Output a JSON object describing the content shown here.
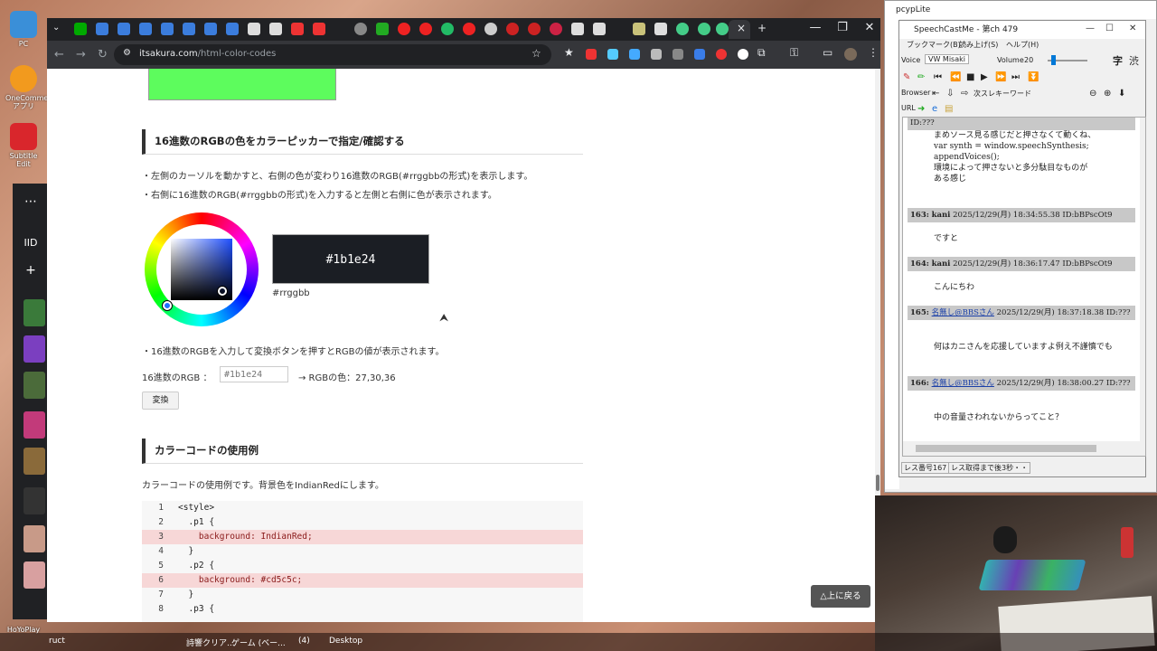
{
  "desktop": {
    "icons": [
      {
        "label": "PC",
        "icon": "pc-icon",
        "color": "#3a8fd8"
      },
      {
        "label": "OneCommeアプリ",
        "icon": "onecomme-icon",
        "color": "#f29a1e"
      },
      {
        "label": "Subtitle Edit",
        "icon": "subtitle-edit-icon",
        "color": "#d9262c"
      }
    ],
    "sidebar_menu": "⋯",
    "sidebar_tab": "IID",
    "sidebar_add": "+",
    "bottom_label": "HoYoPlay"
  },
  "taskbar": {
    "items": [
      "ruct",
      "詩響クリア...",
      "ゲーム (ベー...",
      "(4)",
      "Desktop"
    ]
  },
  "browser": {
    "url_host": "itsakura.com",
    "url_path": "/html-color-codes",
    "tab_close": "×",
    "new_tab": "+",
    "window_controls": [
      "—",
      "❐",
      "✕"
    ],
    "page": {
      "section1_heading": "16進数のRGBの色をカラーピッカーで指定/確認する",
      "bullet1": "・左側のカーソルを動かすと、右側の色が変わり16進数のRGB(#rrggbbの形式)を表示します。",
      "bullet2": "・右側に16進数のRGB(#rrggbbの形式)を入力すると左側と右側に色が表示されます。",
      "picker_value": "#1b1e24",
      "picker_caption": "#rrggbb",
      "bullet3": "・16進数のRGBを入力して変換ボタンを押すとRGBの値が表示されます。",
      "hex_label": "16進数のRGB ：",
      "hex_placeholder": "#1b1e24",
      "rgb_result": "→ RGBの色：27,30,36",
      "convert_button": "変換",
      "section2_heading": "カラーコードの使用例",
      "section2_text": "カラーコードの使用例です。背景色をIndianRedにします。",
      "code_lines": [
        {
          "n": "1",
          "code": "<style>"
        },
        {
          "n": "2",
          "code": "  .p1 {"
        },
        {
          "n": "3",
          "code": "    background: IndianRed;"
        },
        {
          "n": "4",
          "code": "  }"
        },
        {
          "n": "5",
          "code": "  .p2 {"
        },
        {
          "n": "6",
          "code": "    background: #cd5c5c;"
        },
        {
          "n": "7",
          "code": "  }"
        },
        {
          "n": "8",
          "code": "  .p3 {"
        }
      ],
      "back_to_top": "△上に戻る"
    }
  },
  "pcyp": {
    "title": "pcypLite"
  },
  "speechcast": {
    "title": "SpeechCastMe - 第ch 479",
    "menu": [
      "ブックマーク(B)",
      "読み上げ(S)",
      "ヘルプ(H)"
    ],
    "voice_label": "Voice",
    "voice_value": "VW Misaki",
    "volume_label": "Volume",
    "volume_value": "20",
    "kanji_btn": "字",
    "kanji_btn2": "渋",
    "browser_label": "Browser",
    "keyword_label": "次スレキーワード",
    "url_label": "URL",
    "posts": [
      {
        "num": "",
        "name": "",
        "date": "",
        "id": "ID:???",
        "body": "まめソース見る感じだと押さなくて動くね、\nvar synth = window.speechSynthesis;\nappendVoices();\n環境によって押さないと多分駄目なものが\nある感じ"
      },
      {
        "num": "163:",
        "name": "kani",
        "date": "2025/12/29(月) 18:34:55.38",
        "id": "ID:bBPscOt9",
        "body": "ですと"
      },
      {
        "num": "164:",
        "name": "kani",
        "date": "2025/12/29(月) 18:36:17.47",
        "id": "ID:bBPscOt9",
        "body": "こんにちわ"
      },
      {
        "num": "165:",
        "name": "名無し@BBSさん",
        "date": "2025/12/29(月) 18:37:18.38",
        "id": "ID:???",
        "body": "何はカニさんを応援していますよ例え不謹慎でも"
      },
      {
        "num": "166:",
        "name": "名無し@BBSさん",
        "date": "2025/12/29(月) 18:38:00.27",
        "id": "ID:???",
        "body": "中の音量さわれないからってこと？"
      }
    ],
    "status_res": "レス番号167",
    "status_msg": "レス取得まで後3秒・・"
  },
  "colors": {
    "chrome_dark": "#202124",
    "chrome_toolbar": "#35363a",
    "swatch_green": "#5dfc5d",
    "picker_color": "#1b1e24",
    "code_highlight": "#f7d7d7"
  }
}
